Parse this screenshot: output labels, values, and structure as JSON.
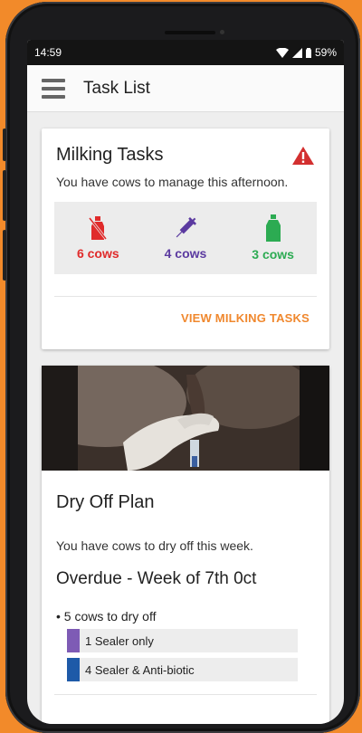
{
  "status_bar": {
    "time": "14:59",
    "battery": "59%"
  },
  "app_bar": {
    "title": "Task List"
  },
  "milking_card": {
    "title": "Milking Tasks",
    "subtitle": "You have cows to manage this afternoon.",
    "counts": [
      {
        "label": "6 cows",
        "color": "#e02b2b",
        "icon": "bottle-crossed-icon"
      },
      {
        "label": "4 cows",
        "color": "#5b3aa0",
        "icon": "syringe-icon"
      },
      {
        "label": "3 cows",
        "color": "#2cab52",
        "icon": "bottle-icon"
      }
    ],
    "action": "VIEW MILKING TASKS"
  },
  "dry_off_card": {
    "title": "Dry Off Plan",
    "subtitle": "You have cows to dry off this week.",
    "section_title": "Overdue - Week of 7th 0ct",
    "bullet": "5 cows to dry off",
    "tags": [
      {
        "label": "1 Sealer only",
        "color": "#7e5bb5"
      },
      {
        "label": "4 Sealer & Anti-biotic",
        "color": "#1e5aa8"
      }
    ]
  },
  "colors": {
    "accent": "#f0882e",
    "alert": "#d32f2f"
  }
}
